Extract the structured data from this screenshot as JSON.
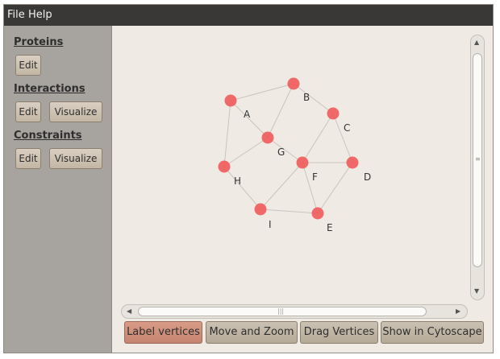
{
  "menubar": {
    "file": "File",
    "help": "Help"
  },
  "sidebar": {
    "proteins": {
      "title": "Proteins",
      "edit": "Edit"
    },
    "interactions": {
      "title": "Interactions",
      "edit": "Edit",
      "visualize": "Visualize"
    },
    "constraints": {
      "title": "Constraints",
      "edit": "Edit",
      "visualize": "Visualize"
    }
  },
  "graph": {
    "vertex_color": "#f05a5a",
    "edge_color": "#c8c4be",
    "vertices": [
      "A",
      "B",
      "C",
      "D",
      "E",
      "F",
      "G",
      "H",
      "I"
    ],
    "edges": [
      [
        "A",
        "B"
      ],
      [
        "A",
        "G"
      ],
      [
        "A",
        "H"
      ],
      [
        "B",
        "G"
      ],
      [
        "B",
        "C"
      ],
      [
        "C",
        "F"
      ],
      [
        "C",
        "D"
      ],
      [
        "G",
        "F"
      ],
      [
        "G",
        "H"
      ],
      [
        "F",
        "D"
      ],
      [
        "F",
        "E"
      ],
      [
        "F",
        "I"
      ],
      [
        "H",
        "I"
      ],
      [
        "I",
        "E"
      ],
      [
        "E",
        "D"
      ]
    ]
  },
  "toolbar": {
    "label_vertices": "Label vertices",
    "move_zoom": "Move and Zoom",
    "drag_vertices": "Drag Vertices",
    "show_cytoscape": "Show in Cytoscape"
  }
}
